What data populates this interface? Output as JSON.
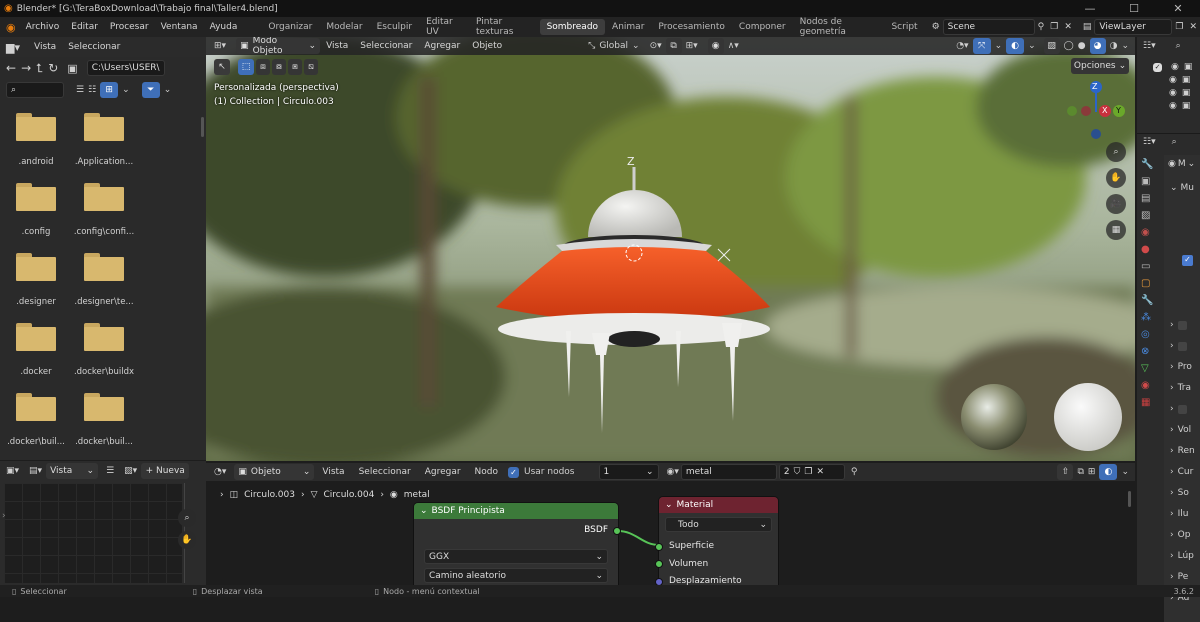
{
  "titlebar": {
    "title": "Blender* [G:\\TeraBoxDownload\\Trabajo final\\Taller4.blend]",
    "minimize": "—",
    "maximize": "☐",
    "close": "✕"
  },
  "menubar": {
    "menus": [
      "Archivo",
      "Editar",
      "Procesar",
      "Ventana",
      "Ayuda"
    ],
    "workspaces": [
      "Organizar",
      "Modelar",
      "Esculpir",
      "Editar UV",
      "Pintar texturas",
      "Sombreado",
      "Animar",
      "Procesamiento",
      "Componer",
      "Nodos de geometría",
      "Script"
    ],
    "active_workspace": "Sombreado",
    "scene": "Scene",
    "view_layer": "ViewLayer"
  },
  "file_browser": {
    "menus": [
      "Vista",
      "Seleccionar"
    ],
    "path": "C:\\Users\\USER\\",
    "items": [
      ".android",
      ".Application...",
      ".config",
      ".config\\confi...",
      ".designer",
      ".designer\\te...",
      ".docker",
      ".docker\\buildx",
      ".docker\\buil...",
      ".docker\\buil..."
    ]
  },
  "viewport": {
    "mode": "Modo Objeto",
    "menus": [
      "Vista",
      "Seleccionar",
      "Agregar",
      "Objeto"
    ],
    "orientation": "Global",
    "options": "Opciones",
    "view_name": "Personalizada (perspectiva)",
    "collection_info": "(1) Collection | Circulo.003",
    "gizmo": {
      "z": "Z",
      "y": "Y",
      "x": "X"
    },
    "accent": "#3f6fb8"
  },
  "image_editor": {
    "view": "Vista",
    "new_label": "+ Nueva"
  },
  "node_editor": {
    "type": "Objeto",
    "menus": [
      "Vista",
      "Seleccionar",
      "Agregar",
      "Nodo"
    ],
    "use_nodes": "Usar nodos",
    "slot": "1",
    "material": "metal",
    "users": "2",
    "breadcrumb": [
      "Circulo.003",
      "Circulo.004",
      "metal"
    ],
    "bsdf": {
      "title": "BSDF Principista",
      "output": "BSDF",
      "distribution": "GGX",
      "subsurface": "Camino aleatorio",
      "header_color": "#3c7a3a"
    },
    "output": {
      "title": "Material",
      "target": "Todo",
      "inputs": [
        "Superficie",
        "Volumen",
        "Desplazamiento"
      ],
      "header_color": "#6e2330"
    }
  },
  "properties": {
    "labels": [
      "Mu",
      "Pro",
      "Tra",
      "Vol",
      "Ren",
      "Cur",
      "So",
      "Ilu",
      "Op",
      "Lúp",
      "Pe",
      "Ad"
    ]
  },
  "statusbar": {
    "select": "Seleccionar",
    "pan": "Desplazar vista",
    "context": "Nodo - menú contextual",
    "version": "3.6.2"
  }
}
